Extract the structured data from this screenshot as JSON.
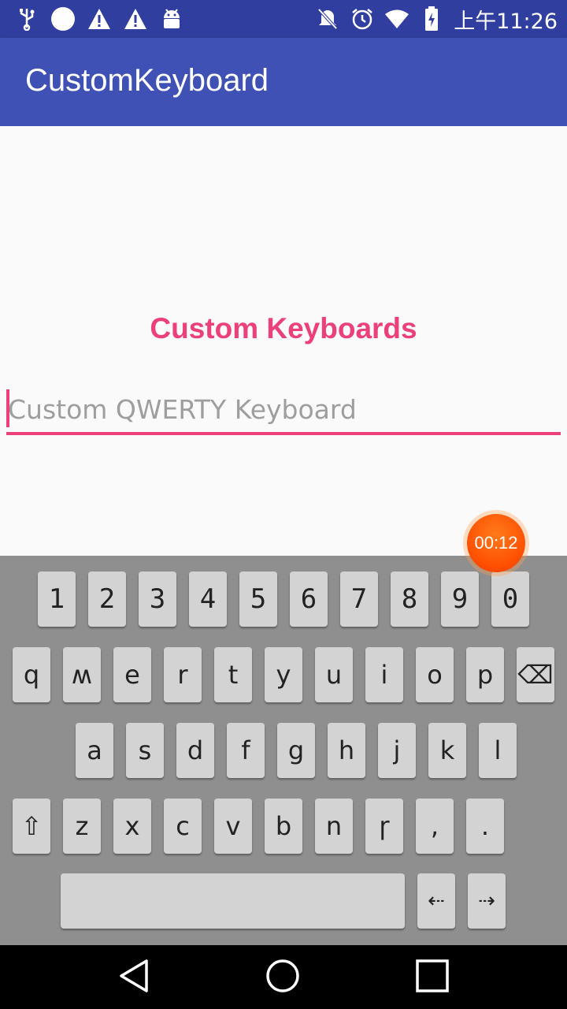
{
  "status_bar": {
    "time": "上午11:26",
    "icons": [
      "usb-icon",
      "circle-notification-icon",
      "warning-icon",
      "warning-icon",
      "android-debug-icon",
      "mute-icon",
      "alarm-icon",
      "wifi-icon",
      "battery-charging-icon"
    ]
  },
  "app_bar": {
    "title": "CustomKeyboard"
  },
  "main": {
    "heading": "Custom Keyboards",
    "input": {
      "value": "",
      "placeholder": "Custom QWERTY Keyboard"
    }
  },
  "timer": {
    "label": "00:12"
  },
  "keyboard": {
    "number_row": [
      "1",
      "2",
      "3",
      "4",
      "5",
      "6",
      "7",
      "8",
      "9",
      "0"
    ],
    "row1": [
      "q",
      "ʍ",
      "e",
      "r",
      "t",
      "y",
      "u",
      "i",
      "o",
      "p"
    ],
    "row2": [
      "a",
      "s",
      "d",
      "f",
      "g",
      "h",
      "j",
      "k",
      "l"
    ],
    "row3": [
      "z",
      "x",
      "c",
      "v",
      "b",
      "n",
      "ɼ",
      ",",
      "."
    ],
    "shift_glyph": "⇧",
    "backspace_glyph": "⌫",
    "left_arrow_glyph": "⇠",
    "right_arrow_glyph": "⇢"
  },
  "nav_bar": {
    "icons": [
      "back-icon",
      "home-icon",
      "recents-icon"
    ]
  },
  "colors": {
    "primary": "#3f51b5",
    "primary_dark": "#303f9f",
    "accent": "#ec407a",
    "keyboard_bg": "#8f8f8f",
    "key_bg": "#d3d3d3"
  }
}
